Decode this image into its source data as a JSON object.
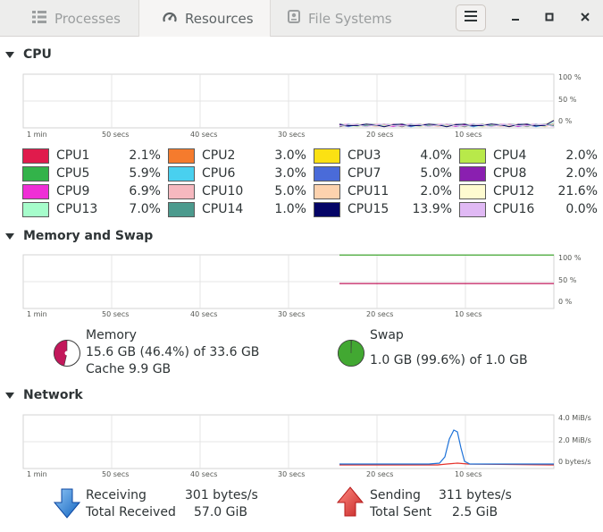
{
  "tabs": [
    {
      "label": "Processes",
      "icon": "processes-icon",
      "active": false
    },
    {
      "label": "Resources",
      "icon": "gauge-icon",
      "active": true
    },
    {
      "label": "File Systems",
      "icon": "disk-icon",
      "active": false
    }
  ],
  "cpu": {
    "title": "CPU",
    "y_labels": [
      "100 %",
      "50 %",
      "0 %"
    ],
    "x_labels": [
      "1 min",
      "50 secs",
      "40 secs",
      "30 secs",
      "20 secs",
      "10 secs"
    ],
    "items": [
      {
        "name": "CPU1",
        "value": "2.1%",
        "color": "#e01b4c"
      },
      {
        "name": "CPU2",
        "value": "3.0%",
        "color": "#f57b2d"
      },
      {
        "name": "CPU3",
        "value": "4.0%",
        "color": "#fbe113"
      },
      {
        "name": "CPU4",
        "value": "2.0%",
        "color": "#b8e94a"
      },
      {
        "name": "CPU5",
        "value": "5.9%",
        "color": "#33b34a"
      },
      {
        "name": "CPU6",
        "value": "3.0%",
        "color": "#49d0ef"
      },
      {
        "name": "CPU7",
        "value": "5.0%",
        "color": "#4a6bd9"
      },
      {
        "name": "CPU8",
        "value": "2.0%",
        "color": "#8a1fb0"
      },
      {
        "name": "CPU9",
        "value": "6.9%",
        "color": "#ef2fd6"
      },
      {
        "name": "CPU10",
        "value": "5.0%",
        "color": "#f6b8bf"
      },
      {
        "name": "CPU11",
        "value": "2.0%",
        "color": "#fdd2ae"
      },
      {
        "name": "CPU12",
        "value": "21.6%",
        "color": "#fefbd0"
      },
      {
        "name": "CPU13",
        "value": "7.0%",
        "color": "#a6fccb"
      },
      {
        "name": "CPU14",
        "value": "1.0%",
        "color": "#4c9a8d"
      },
      {
        "name": "CPU15",
        "value": "13.9%",
        "color": "#050466"
      },
      {
        "name": "CPU16",
        "value": "0.0%",
        "color": "#e0b9f4"
      }
    ]
  },
  "memory": {
    "title": "Memory and Swap",
    "y_labels": [
      "100 %",
      "50 %",
      "0 %"
    ],
    "x_labels": [
      "1 min",
      "50 secs",
      "40 secs",
      "30 secs",
      "20 secs",
      "10 secs"
    ],
    "memory_label": "Memory",
    "memory_line": "15.6 GB (46.4%) of 33.6 GB",
    "cache_line": "Cache 9.9 GB",
    "memory_fraction": 0.464,
    "memory_color": "#c2185b",
    "swap_label": "Swap",
    "swap_line": "1.0 GB (99.6%) of 1.0 GB",
    "swap_fraction": 0.996,
    "swap_color": "#42a832"
  },
  "network": {
    "title": "Network",
    "y_labels": [
      "4.0 MiB/s",
      "2.0 MiB/s",
      "0 bytes/s"
    ],
    "x_labels": [
      "1 min",
      "50 secs",
      "40 secs",
      "30 secs",
      "20 secs",
      "10 secs"
    ],
    "receiving_label": "Receiving",
    "receiving_value": "301 bytes/s",
    "total_received_label": "Total Received",
    "total_received_value": "57.0 GiB",
    "sending_label": "Sending",
    "sending_value": "311 bytes/s",
    "total_sent_label": "Total Sent",
    "total_sent_value": "2.5 GiB",
    "receive_color": "#1c71d8",
    "send_color": "#e5322b"
  }
}
